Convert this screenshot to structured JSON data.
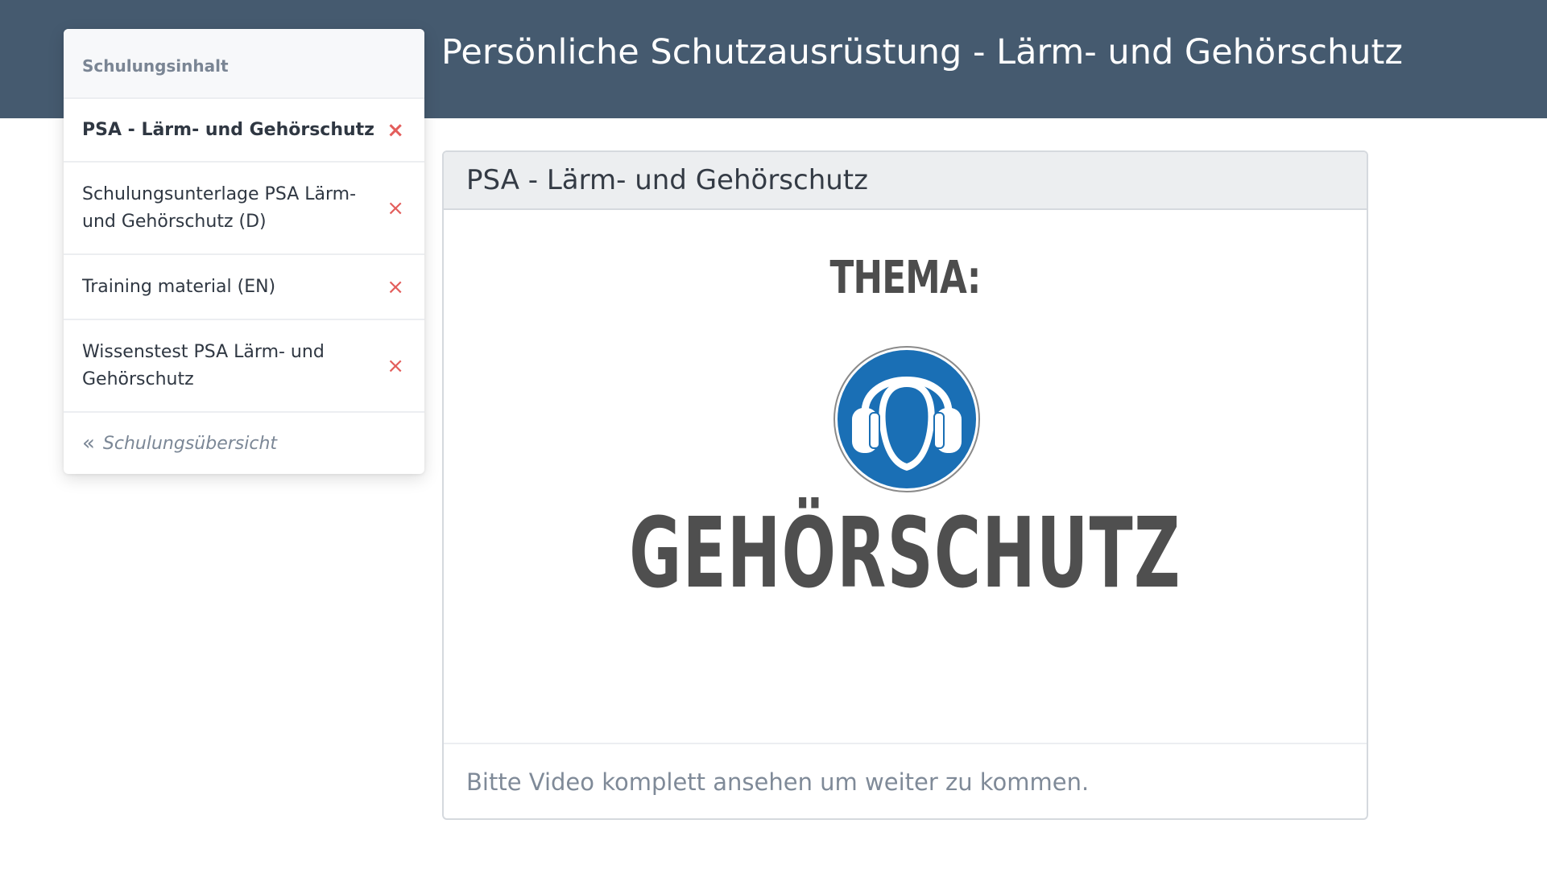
{
  "header": {
    "title": "Persönliche Schutzausrüstung - Lärm- und Gehörschutz"
  },
  "sidebar": {
    "heading": "Schulungsinhalt",
    "items": [
      {
        "label": "PSA - Lärm- und Gehörschutz",
        "active": true,
        "status_icon": "close-icon"
      },
      {
        "label": "Schulungsunterlage PSA Lärm- und Gehörschutz (D)",
        "active": false,
        "status_icon": "close-icon"
      },
      {
        "label": "Training material (EN)",
        "active": false,
        "status_icon": "close-icon"
      },
      {
        "label": "Wissenstest PSA Lärm- und Gehörschutz",
        "active": false,
        "status_icon": "close-icon"
      }
    ],
    "status_symbol": "×",
    "back_icon": "«",
    "back_label": "Schulungsübersicht"
  },
  "content": {
    "card_title": "PSA - Lärm- und Gehörschutz",
    "media": {
      "caption_top": "THEMA:",
      "caption_main": "GEHÖRSCHUTZ",
      "sign_icon": "ear-protection-sign-icon"
    },
    "footer_note": "Bitte Video komplett ansehen um weiter zu kommen."
  },
  "colors": {
    "header_bg": "#455a6f",
    "sign_blue": "#1a6fb5",
    "status_red": "#e35d5b"
  }
}
